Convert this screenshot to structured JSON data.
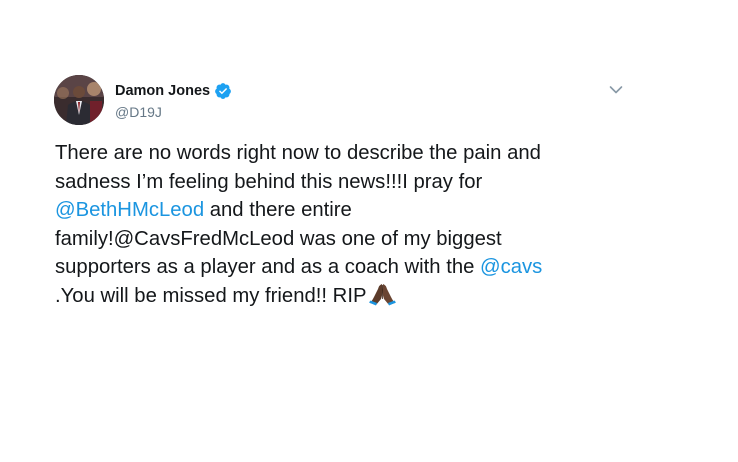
{
  "author": {
    "display_name": "Damon Jones",
    "handle": "@D19J",
    "verified": true,
    "avatar_icon": "profile-photo-icon"
  },
  "menu": {
    "icon": "chevron-down-icon"
  },
  "tweet": {
    "line1": "There are no words right now to describe the pain and",
    "line2": "sadness I’m feeling behind this news!!!I pray for",
    "line3_mention": "@BethHMcLeod",
    "line3_text": " and there entire",
    "line4": "family!@CavsFredMcLeod was one of my biggest",
    "line5_text": "supporters as a player and as a coach with the ",
    "line5_mention": "@cavs",
    "line6": ".You will be missed my friend!! RIP",
    "emoji_icon": "folded-hands-icon"
  },
  "colors": {
    "link": "#1b95e0",
    "text": "#14171a",
    "secondary": "#657786",
    "verified": "#1da1f2",
    "background": "#ffffff"
  }
}
